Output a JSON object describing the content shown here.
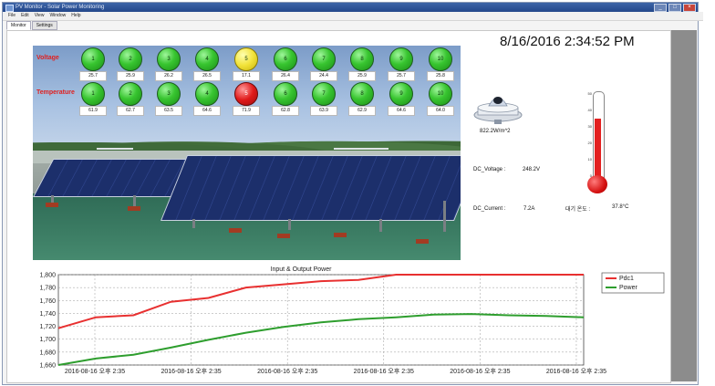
{
  "window": {
    "title": "PV Monitor - Solar Power Monitoring",
    "controls": [
      "_",
      "□",
      "×"
    ]
  },
  "menu": [
    "File",
    "Edit",
    "View",
    "Window",
    "Help"
  ],
  "tabs": [
    "Monitor",
    "Settings"
  ],
  "datetime": "8/16/2016 2:34:52 PM",
  "indicators": {
    "voltage_label": "Voltage",
    "temperature_label": "Temperature",
    "voltage": [
      {
        "id": "1",
        "value": "25.7",
        "status": "green"
      },
      {
        "id": "2",
        "value": "25.9",
        "status": "green"
      },
      {
        "id": "3",
        "value": "26.2",
        "status": "green"
      },
      {
        "id": "4",
        "value": "26.5",
        "status": "green"
      },
      {
        "id": "5",
        "value": "17.1",
        "status": "yellow"
      },
      {
        "id": "6",
        "value": "26.4",
        "status": "green"
      },
      {
        "id": "7",
        "value": "24.4",
        "status": "green"
      },
      {
        "id": "8",
        "value": "25.9",
        "status": "green"
      },
      {
        "id": "9",
        "value": "25.7",
        "status": "green"
      },
      {
        "id": "10",
        "value": "25.8",
        "status": "green"
      }
    ],
    "temperature": [
      {
        "id": "1",
        "value": "61.9",
        "status": "green"
      },
      {
        "id": "2",
        "value": "62.7",
        "status": "green"
      },
      {
        "id": "3",
        "value": "63.5",
        "status": "green"
      },
      {
        "id": "4",
        "value": "64.6",
        "status": "green"
      },
      {
        "id": "5",
        "value": "71.9",
        "status": "red"
      },
      {
        "id": "6",
        "value": "62.8",
        "status": "green"
      },
      {
        "id": "7",
        "value": "63.9",
        "status": "green"
      },
      {
        "id": "8",
        "value": "62.9",
        "status": "green"
      },
      {
        "id": "9",
        "value": "64.6",
        "status": "green"
      },
      {
        "id": "10",
        "value": "64.0",
        "status": "green"
      }
    ]
  },
  "irradiance": "822.2W/m^2",
  "dc_voltage_label": "DC_Voltage :",
  "dc_voltage": "248.2V",
  "dc_current_label": "DC_Current :",
  "dc_current": "7.2A",
  "temp_label": "대기 온도 :",
  "temp_value": "37.8°C",
  "thermometer": {
    "ticks": [
      "50",
      "40",
      "30",
      "20",
      "10",
      "0"
    ],
    "level": 37.8,
    "max": 50
  },
  "colors": {
    "pdc1": "#e83030",
    "power": "#2e9e2e"
  },
  "chart_data": {
    "type": "line",
    "title": "Input & Output Power",
    "x": [
      "2016-08-16 오후 2:35",
      "2016-08-16 오후 2:35",
      "2016-08-16 오후 2:35",
      "2016-08-16 오후 2:35",
      "2016-08-16 오후 2:35",
      "2016-08-16 오후 2:35"
    ],
    "ylim": [
      1660,
      1800
    ],
    "yticks": [
      "1,800",
      "1,780",
      "1,760",
      "1,740",
      "1,720",
      "1,700",
      "1,680",
      "1,660"
    ],
    "grid": true,
    "legend": "top-right",
    "series": [
      {
        "name": "Pdc1",
        "values": [
          1717,
          1734,
          1737,
          1758,
          1764,
          1780,
          1785,
          1790,
          1792,
          1800,
          1800,
          1800,
          1800,
          1800,
          1800
        ]
      },
      {
        "name": "Power",
        "values": [
          1660,
          1670,
          1676,
          1687,
          1699,
          1710,
          1719,
          1726,
          1731,
          1734,
          1738,
          1739,
          1737,
          1736,
          1734
        ]
      }
    ]
  }
}
